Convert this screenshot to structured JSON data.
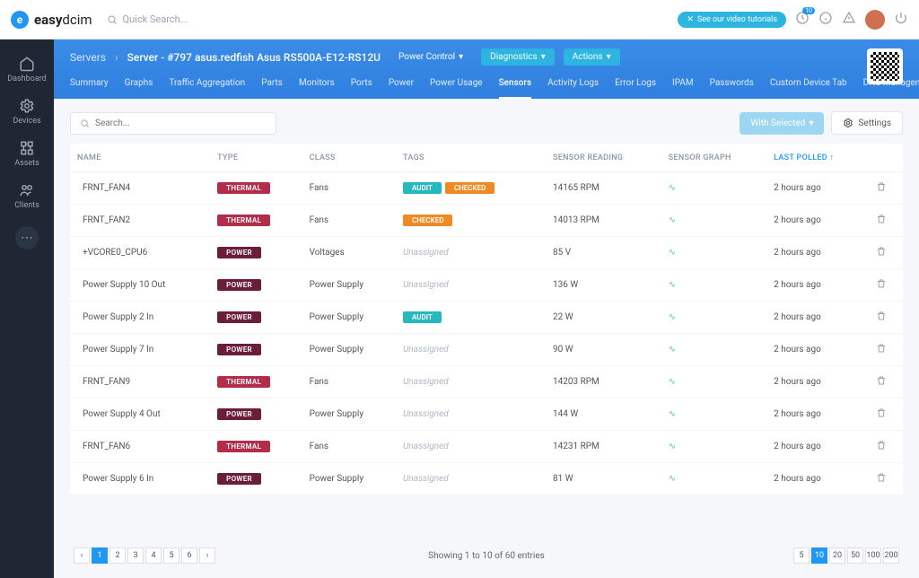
{
  "topbar": {
    "logo_bold": "easy",
    "logo_thin": "dcim",
    "search_placeholder": "Quick Search...",
    "video_btn": "See our video tutorials",
    "notif_count": "10"
  },
  "sidebar": {
    "items": [
      {
        "label": "Dashboard"
      },
      {
        "label": "Devices"
      },
      {
        "label": "Assets"
      },
      {
        "label": "Clients"
      }
    ]
  },
  "header": {
    "breadcrumb_root": "Servers",
    "breadcrumb_title": "Server - #797 asus.redfish Asus RS500A-E12-RS12U",
    "btn_power": "Power Control",
    "btn_diag": "Diagnostics",
    "btn_actions": "Actions"
  },
  "tabs": [
    "Summary",
    "Graphs",
    "Traffic Aggregation",
    "Parts",
    "Monitors",
    "Ports",
    "Power",
    "Power Usage",
    "Sensors",
    "Activity Logs",
    "Error Logs",
    "IPAM",
    "Passwords",
    "Custom Device Tab",
    "DNS Management"
  ],
  "active_tab": "Sensors",
  "toolbar": {
    "search_placeholder": "Search...",
    "with_selected": "With Selected",
    "settings": "Settings"
  },
  "columns": [
    "NAME",
    "TYPE",
    "CLASS",
    "TAGS",
    "SENSOR READING",
    "SENSOR GRAPH",
    "LAST POLLED"
  ],
  "sorted_col": "LAST POLLED",
  "rows": [
    {
      "name": "FRNT_FAN4",
      "type": "THERMAL",
      "class": "Fans",
      "tags": [
        "AUDIT",
        "CHECKED"
      ],
      "reading": "14165 RPM",
      "polled": "2 hours ago"
    },
    {
      "name": "FRNT_FAN2",
      "type": "THERMAL",
      "class": "Fans",
      "tags": [
        "CHECKED"
      ],
      "reading": "14013 RPM",
      "polled": "2 hours ago"
    },
    {
      "name": "+VCORE0_CPU6",
      "type": "POWER",
      "class": "Voltages",
      "tags": [],
      "reading": "85 V",
      "polled": "2 hours ago"
    },
    {
      "name": "Power Supply 10 Out",
      "type": "POWER",
      "class": "Power Supply",
      "tags": [],
      "reading": "136 W",
      "polled": "2 hours ago"
    },
    {
      "name": "Power Supply 2 In",
      "type": "POWER",
      "class": "Power Supply",
      "tags": [
        "AUDIT"
      ],
      "reading": "22 W",
      "polled": "2 hours ago"
    },
    {
      "name": "Power Supply 7 In",
      "type": "POWER",
      "class": "Power Supply",
      "tags": [],
      "reading": "90 W",
      "polled": "2 hours ago"
    },
    {
      "name": "FRNT_FAN9",
      "type": "THERMAL",
      "class": "Fans",
      "tags": [],
      "reading": "14203 RPM",
      "polled": "2 hours ago"
    },
    {
      "name": "Power Supply 4 Out",
      "type": "POWER",
      "class": "Power Supply",
      "tags": [],
      "reading": "144 W",
      "polled": "2 hours ago"
    },
    {
      "name": "FRNT_FAN6",
      "type": "THERMAL",
      "class": "Fans",
      "tags": [],
      "reading": "14231 RPM",
      "polled": "2 hours ago"
    },
    {
      "name": "Power Supply 6 In",
      "type": "POWER",
      "class": "Power Supply",
      "tags": [],
      "reading": "81 W",
      "polled": "2 hours ago"
    }
  ],
  "unassigned_label": "Unassigned",
  "footer": {
    "pages": [
      "1",
      "2",
      "3",
      "4",
      "5",
      "6"
    ],
    "active_page": "1",
    "showing": "Showing 1 to 10 of 60 entries",
    "sizes": [
      "5",
      "10",
      "20",
      "50",
      "100",
      "200"
    ],
    "active_size": "10"
  }
}
